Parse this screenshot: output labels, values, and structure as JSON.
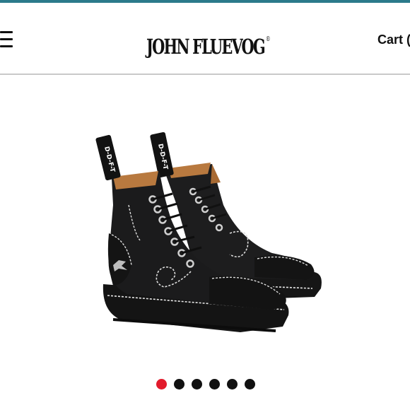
{
  "header": {
    "brand": "JOHN FLUEVOG",
    "registered_mark": "®",
    "cart_label": "Cart (",
    "menu_icon": "hamburger-menu-icon"
  },
  "product": {
    "image_alt": "Black lace-up boots with white contrast stitching, swirl detail and D-D-F-T pull tabs"
  },
  "gallery": {
    "total_images": 6,
    "active_index": 0,
    "colors": {
      "active": "#e21b2c",
      "inactive": "#111111"
    }
  },
  "colors": {
    "accent_strip": "#2b7a8b",
    "text": "#111111"
  }
}
